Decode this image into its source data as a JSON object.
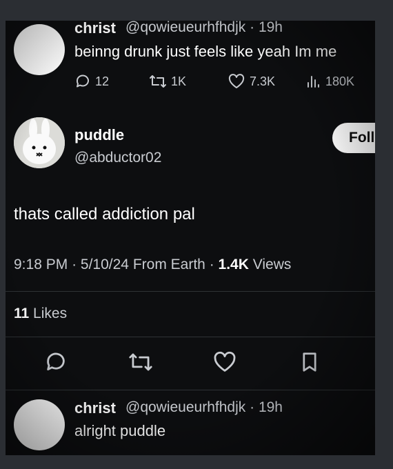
{
  "top_reply": {
    "name": "christ",
    "handle": "@qowieueurhfhdjk",
    "sep": "·",
    "time": "19h",
    "text": "beinng drunk just feels like yeah Im me",
    "replies": "12",
    "reposts": "1K",
    "likes": "7.3K",
    "views": "180K"
  },
  "main_tweet": {
    "name": "puddle",
    "handle": "@abductor02",
    "follow_label": "Follow",
    "text": "thats called addiction pal",
    "time": "9:18 PM",
    "date_sep": "·",
    "date": "5/10/24",
    "source": "From Earth",
    "views_sep": "·",
    "views_count": "1.4K",
    "views_label": "Views",
    "likes_count": "11",
    "likes_label": "Likes"
  },
  "bottom_reply": {
    "name": "christ",
    "handle": "@qowieueurhfhdjk",
    "sep": "·",
    "time": "19h",
    "text": "alright puddle"
  },
  "colors": {
    "background": "#0d0e10",
    "text": "#ffffff",
    "secondary": "#c9ccd1",
    "follow_bg": "#ffffff"
  }
}
